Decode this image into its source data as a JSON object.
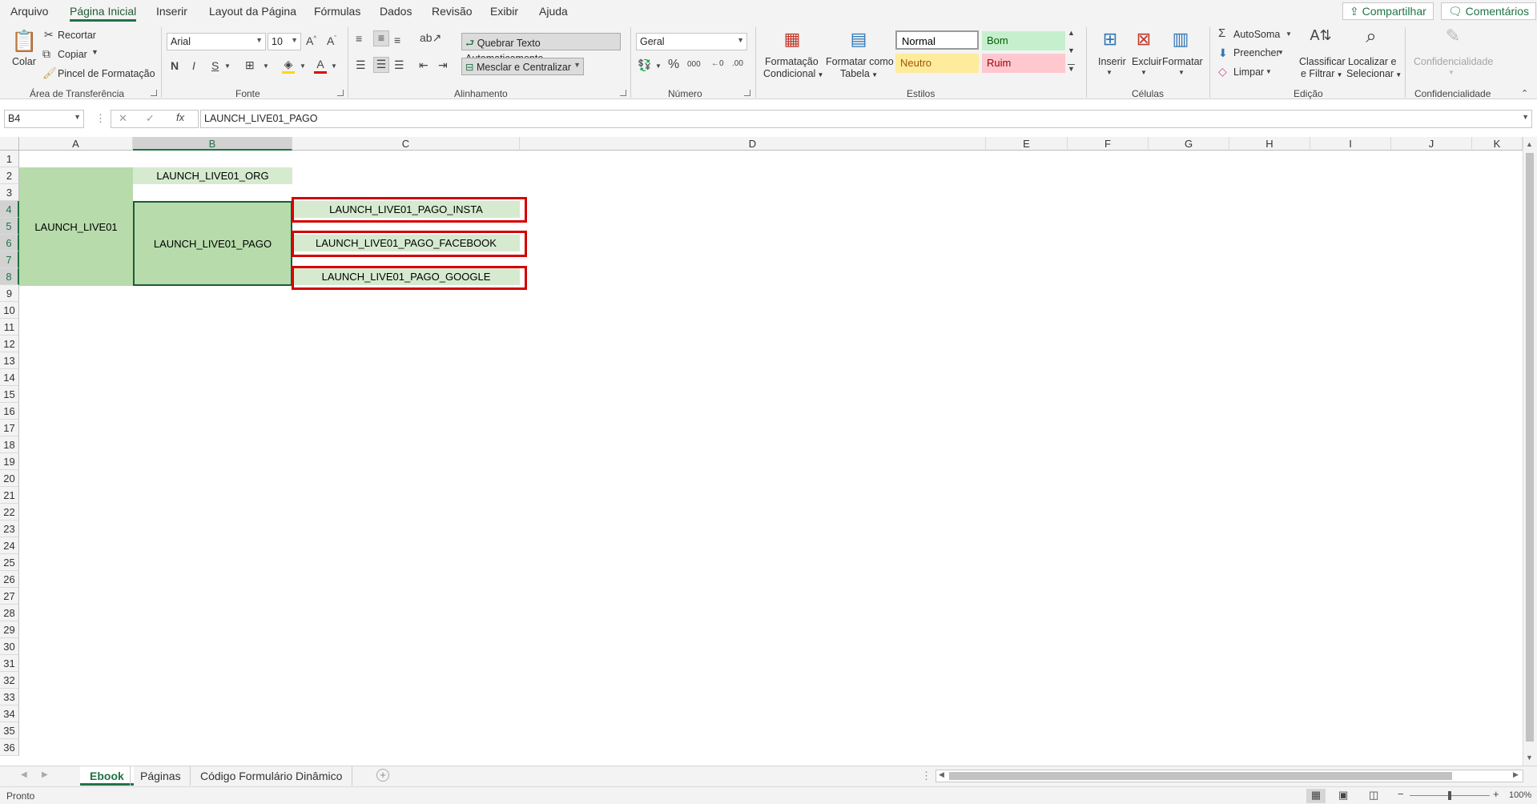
{
  "menu": {
    "items": [
      "Arquivo",
      "Página Inicial",
      "Inserir",
      "Layout da Página",
      "Fórmulas",
      "Dados",
      "Revisão",
      "Exibir",
      "Ajuda"
    ],
    "share_label": "Compartilhar",
    "comments_label": "Comentários"
  },
  "ribbon": {
    "clipboard": {
      "paste": "Colar",
      "cut": "Recortar",
      "copy": "Copiar",
      "format_painter": "Pincel de Formatação",
      "group": "Área de Transferência"
    },
    "font": {
      "name": "Arial",
      "size": "10",
      "bold": "N",
      "italic": "I",
      "underline": "S",
      "group": "Fonte"
    },
    "alignment": {
      "wrap": "Quebrar Texto Automaticamente",
      "merge": "Mesclar e Centralizar",
      "group": "Alinhamento"
    },
    "number": {
      "format": "Geral",
      "group": "Número"
    },
    "styles": {
      "conditional_1": "Formatação",
      "conditional_2": "Condicional",
      "table_1": "Formatar como",
      "table_2": "Tabela",
      "normal": "Normal",
      "good": "Bom",
      "neutral": "Neutro",
      "bad": "Ruim",
      "group": "Estilos"
    },
    "cells": {
      "insert": "Inserir",
      "delete": "Excluir",
      "format": "Formatar",
      "group": "Células"
    },
    "editing": {
      "autosum": "AutoSoma",
      "fill": "Preencher",
      "clear": "Limpar",
      "sort_1": "Classificar",
      "sort_2": "e Filtrar",
      "find_1": "Localizar e",
      "find_2": "Selecionar",
      "group": "Edição"
    },
    "sensitivity": {
      "label": "Confidencialidade",
      "group": "Confidencialidade"
    }
  },
  "formula_bar": {
    "name_box": "B4",
    "fx": "fx",
    "content": "LAUNCH_LIVE01_PAGO"
  },
  "columns": [
    "A",
    "B",
    "C",
    "D",
    "E",
    "F",
    "G",
    "H",
    "I",
    "J",
    "K"
  ],
  "rows": [
    "1",
    "2",
    "3",
    "4",
    "5",
    "6",
    "7",
    "8",
    "9",
    "10",
    "11",
    "12",
    "13",
    "14",
    "15",
    "16",
    "17",
    "18",
    "19",
    "20",
    "21",
    "22",
    "23",
    "24",
    "25",
    "26",
    "27",
    "28",
    "29",
    "30",
    "31",
    "32",
    "33",
    "34",
    "35",
    "36"
  ],
  "cells": {
    "a_merged": "LAUNCH_LIVE01",
    "b2": "LAUNCH_LIVE01_ORG",
    "b_merged": "LAUNCH_LIVE01_PAGO",
    "c4": "LAUNCH_LIVE01_PAGO_INSTA",
    "c6": "LAUNCH_LIVE01_PAGO_FACEBOOK",
    "c8": "LAUNCH_LIVE01_PAGO_GOOGLE"
  },
  "sheets": {
    "tabs": [
      "Ebook",
      "Páginas",
      "Código Formulário Dinâmico"
    ],
    "active": "Ebook"
  },
  "status": {
    "ready": "Pronto",
    "zoom": "100%"
  },
  "colors": {
    "accent": "#217346",
    "cell_green": "#b7dbab",
    "cell_light_green": "#d6ead0",
    "red_outline": "#d40000"
  }
}
